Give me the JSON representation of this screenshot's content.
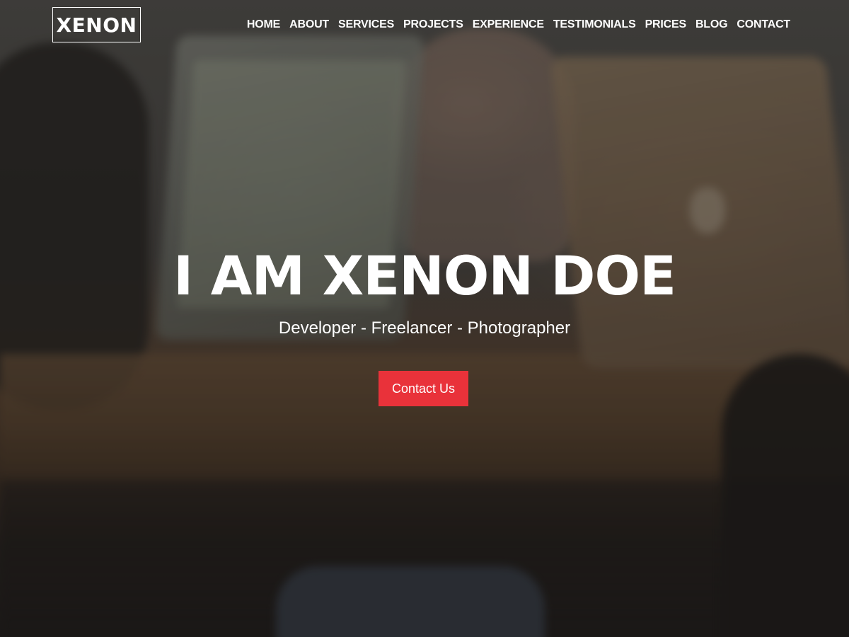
{
  "brand": {
    "logo_text": "XENON"
  },
  "nav": {
    "items": [
      {
        "label": "HOME"
      },
      {
        "label": "ABOUT"
      },
      {
        "label": "SERVICES"
      },
      {
        "label": "PROJECTS"
      },
      {
        "label": "EXPERIENCE"
      },
      {
        "label": "TESTIMONIALS"
      },
      {
        "label": "PRICES"
      },
      {
        "label": "BLOG"
      },
      {
        "label": "CONTACT"
      }
    ]
  },
  "hero": {
    "title": "I AM XENON DOE",
    "subtitle": "Developer - Freelancer - Photographer",
    "cta_label": "Contact Us"
  },
  "colors": {
    "accent": "#e9323a",
    "text": "#ffffff"
  }
}
